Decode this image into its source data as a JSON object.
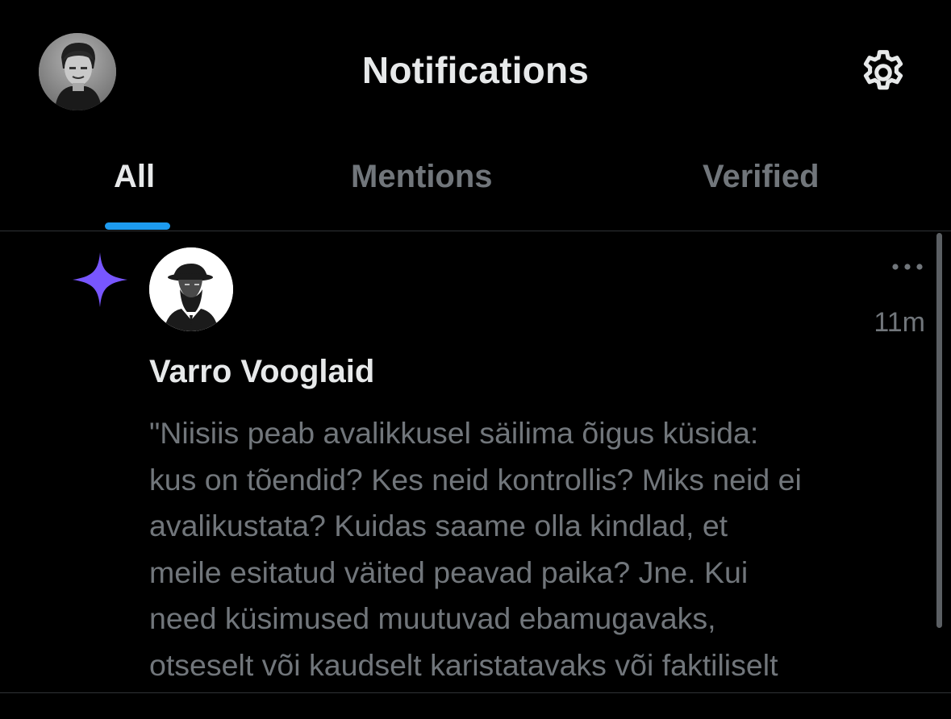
{
  "header": {
    "title": "Notifications",
    "avatar_icon": "user-avatar",
    "settings_icon": "gear-icon"
  },
  "tabs": [
    {
      "label": "All",
      "active": true
    },
    {
      "label": "Mentions",
      "active": false
    },
    {
      "label": "Verified",
      "active": false
    }
  ],
  "notification": {
    "type_icon": "sparkle-star-icon",
    "type_icon_color": "#7856ff",
    "author_name": "Varro Vooglaid",
    "time": "11m",
    "more_icon": "more-dots-icon",
    "text_lines": [
      "\"Niisiis peab avalikkusel säilima õigus küsida:",
      "kus on tõendid? Kes neid kontrollis? Miks neid ei",
      "avalikustata? Kuidas saame olla kindlad, et",
      "meile esitatud väited peavad paika? Jne. Kui",
      "need küsimused muutuvad ebamugavaks,",
      "otseselt või kaudselt karistatavaks või faktiliselt"
    ]
  },
  "colors": {
    "background": "#000000",
    "primary_text": "#e7e9ea",
    "secondary_text": "#71767b",
    "accent": "#1d9bf0",
    "divider": "#2f3336"
  }
}
